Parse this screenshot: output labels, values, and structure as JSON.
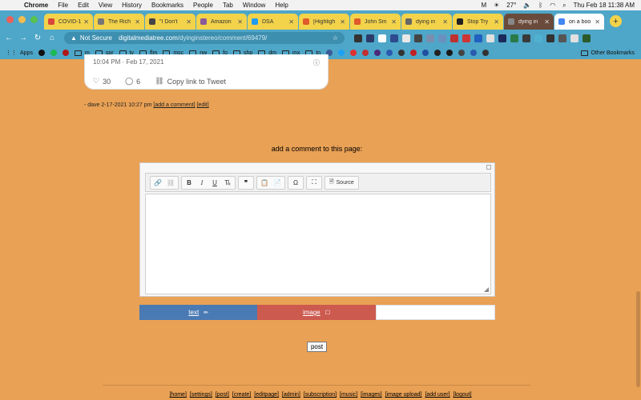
{
  "menubar": {
    "app": "Chrome",
    "items": [
      "File",
      "Edit",
      "View",
      "History",
      "Bookmarks",
      "People",
      "Tab",
      "Window",
      "Help"
    ],
    "temperature": "27°",
    "datetime": "Thu Feb 18  11:38 AM"
  },
  "tabs": [
    {
      "title": "COVID-1",
      "color": "#d9483b"
    },
    {
      "title": "The Rich",
      "color": "#777777"
    },
    {
      "title": "\"I Don't",
      "color": "#444444"
    },
    {
      "title": "Amazon",
      "color": "#8a5a9a"
    },
    {
      "title": "DSA",
      "color": "#1d9bf0"
    },
    {
      "title": "[Highligh",
      "color": "#e05a2b"
    },
    {
      "title": "John Sm",
      "color": "#e05a2b"
    },
    {
      "title": "dying in",
      "color": "#666666"
    },
    {
      "title": "Stop Try",
      "color": "#222222"
    },
    {
      "title": "dying in",
      "color": "#888888"
    },
    {
      "title": "on a boo",
      "color": "#4285f4"
    }
  ],
  "address": {
    "security": "Not Secure",
    "host": "digitalmediatree.com",
    "path": "/dyinginstereo/comment/69479/"
  },
  "bookmarks": {
    "apps": "Apps",
    "folders": [
      "m",
      "spr",
      "tv",
      "flm",
      "msc",
      "nw",
      "fo",
      "shp",
      "dm",
      "mx",
      "tn"
    ],
    "other": "Other Bookmarks"
  },
  "tweet": {
    "timestamp": "10:04 PM · Feb 17, 2021",
    "likes": "30",
    "replies": "6",
    "copy_link": "Copy link to Tweet"
  },
  "byline": {
    "text": "- dave 2-17-2021 10:27 pm",
    "add_comment": "[add a comment]",
    "edit": "[edit]"
  },
  "comment": {
    "heading": "add a comment to this page:",
    "source_label": "Source",
    "tab_text": "text",
    "tab_image": "image",
    "post_label": "post"
  },
  "footer": {
    "links": [
      "[home]",
      "[settings]",
      "[post]",
      "[create]",
      "[editpage]",
      "[admin]",
      "[subscription]",
      "[music]",
      "[images]",
      "[image upload]",
      "[add user]",
      "[logout]"
    ]
  }
}
